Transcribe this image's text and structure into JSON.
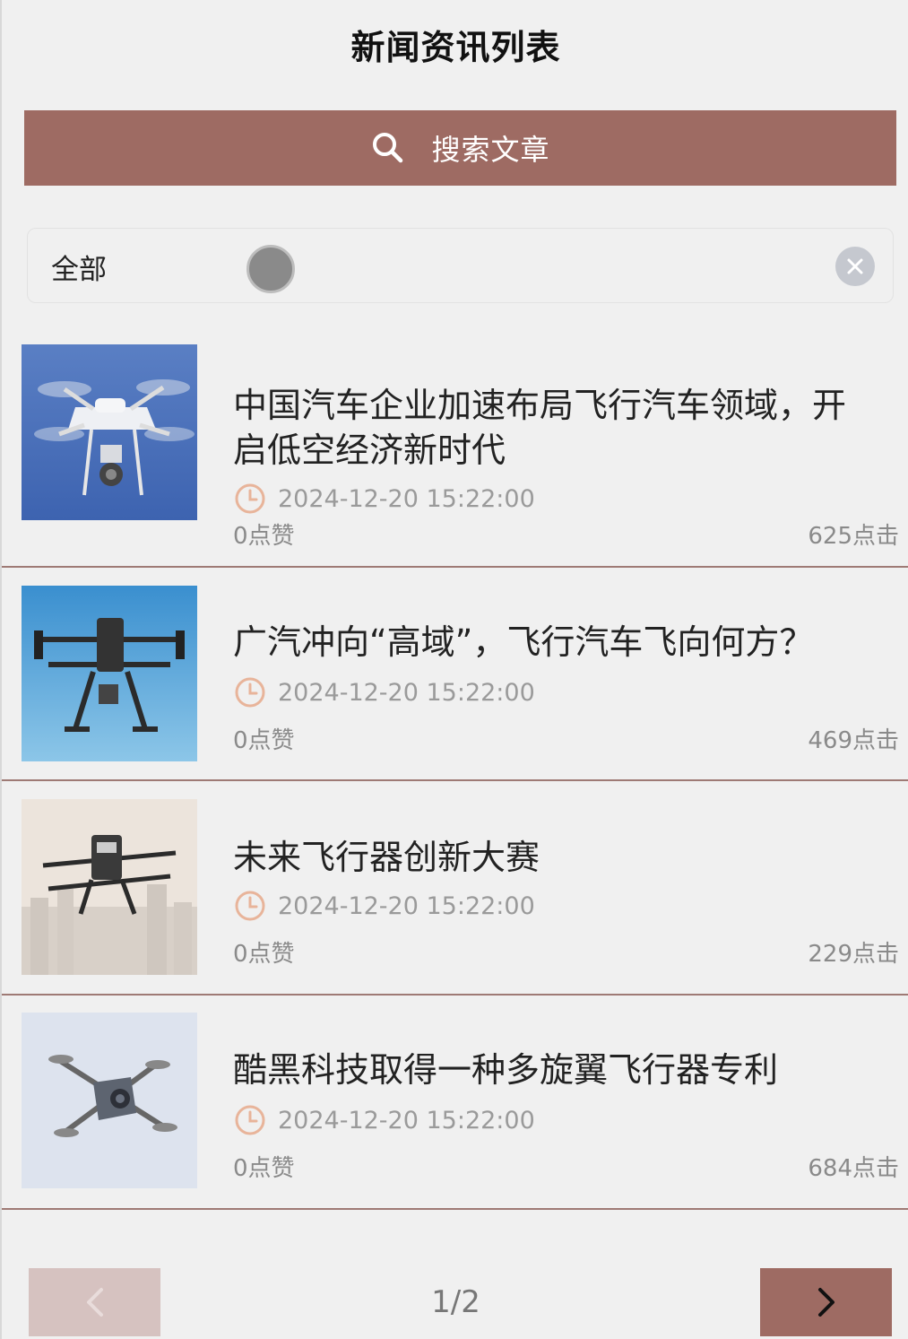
{
  "header": {
    "title": "新闻资讯列表"
  },
  "search": {
    "label": "搜索文章"
  },
  "filter": {
    "label": "全部"
  },
  "news": [
    {
      "title": "中国汽车企业加速布局飞行汽车领域，开启低空经济新时代",
      "time": "2024-12-20 15:22:00",
      "likes": "0点赞",
      "clicks": "625点击"
    },
    {
      "title": "广汽冲向“高域”，飞行汽车飞向何方？",
      "time": "2024-12-20 15:22:00",
      "likes": "0点赞",
      "clicks": "469点击"
    },
    {
      "title": "未来飞行器创新大赛",
      "time": "2024-12-20 15:22:00",
      "likes": "0点赞",
      "clicks": "229点击"
    },
    {
      "title": "酷黑科技取得一种多旋翼飞行器专利",
      "time": "2024-12-20 15:22:00",
      "likes": "0点赞",
      "clicks": "684点击"
    }
  ],
  "pagination": {
    "indicator": "1/2"
  },
  "colors": {
    "accent": "#9e6b63",
    "accent_light": "#d6c2c0",
    "clock": "#e8b49a",
    "divider": "#9e7a75"
  },
  "icons": {
    "search": "search-icon",
    "clear": "close-icon",
    "clock": "clock-icon",
    "prev": "chevron-left-icon",
    "next": "chevron-right-icon"
  }
}
